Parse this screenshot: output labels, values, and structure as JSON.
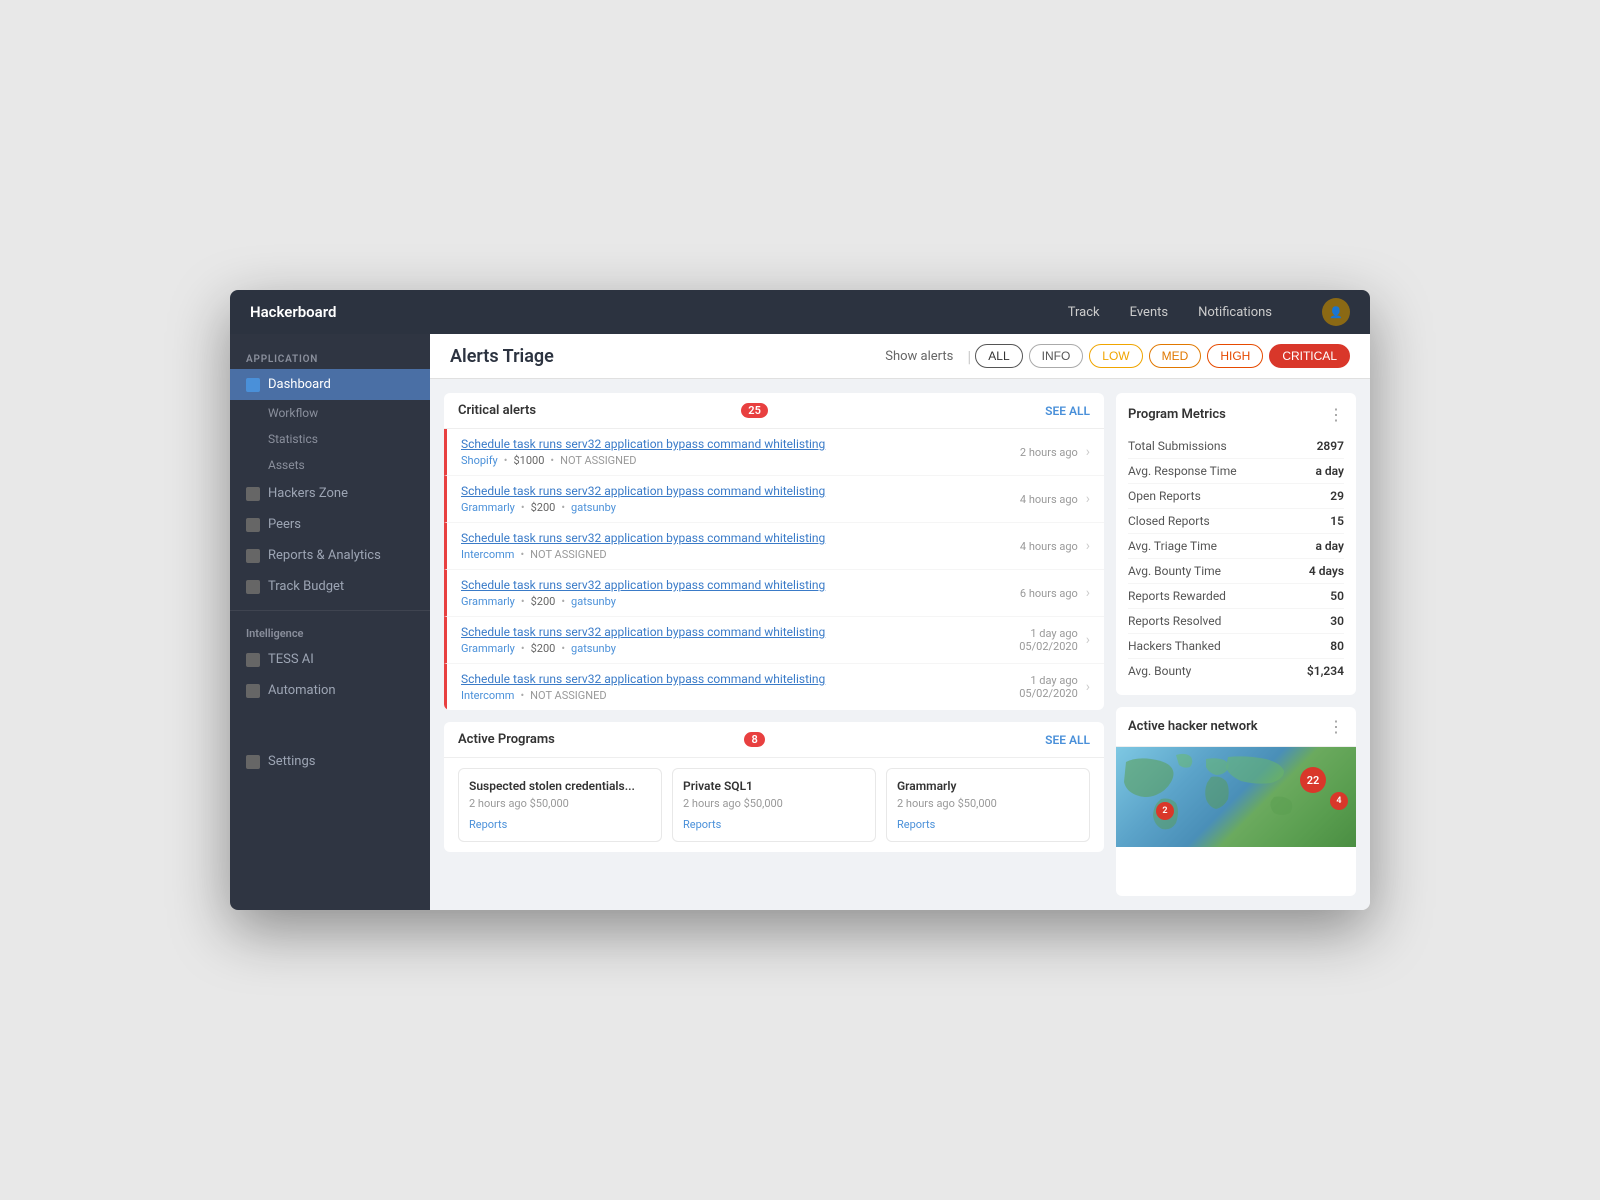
{
  "app": {
    "brand": "Hackerboard",
    "nav_links": [
      "Track",
      "Events",
      "Notifications"
    ]
  },
  "sidebar": {
    "section_application": "APPLICATION",
    "section_intelligence": "Intelligence",
    "items_application": [
      {
        "label": "Dashboard",
        "active": true
      },
      {
        "label": "Workflow",
        "sub": true
      },
      {
        "label": "Statistics",
        "sub": true
      },
      {
        "label": "Assets",
        "sub": true
      },
      {
        "label": "Hackers Zone",
        "active": false
      },
      {
        "label": "Peers",
        "active": false
      },
      {
        "label": "Reports & Analytics",
        "active": false
      },
      {
        "label": "Track Budget",
        "active": false
      }
    ],
    "items_intelligence": [
      {
        "label": "TESS AI"
      },
      {
        "label": "Automation"
      }
    ],
    "settings": "Settings"
  },
  "page": {
    "title": "Alerts Triage",
    "show_alerts": "Show alerts",
    "filters": [
      "ALL",
      "INFO",
      "LOW",
      "MED",
      "HIGH",
      "CRITICAL"
    ]
  },
  "critical_alerts": {
    "title": "Critical alerts",
    "count": 25,
    "see_all": "SEE ALL",
    "items": [
      {
        "title": "Schedule task runs serv32 application bypass command whitelisting",
        "company": "Shopify",
        "amount": "$1000",
        "assigned": "NOT ASSIGNED",
        "time": "2 hours ago",
        "assigned_type": "unassigned"
      },
      {
        "title": "Schedule task runs serv32 application bypass command whitelisting",
        "company": "Grammarly",
        "amount": "$200",
        "assigned": "gatsunby",
        "time": "4 hours ago",
        "assigned_type": "assigned"
      },
      {
        "title": "Schedule task runs serv32 application bypass command whitelisting",
        "company": "Intercomm",
        "amount": "",
        "assigned": "NOT ASSIGNED",
        "time": "4 hours ago",
        "assigned_type": "unassigned"
      },
      {
        "title": "Schedule task runs serv32 application bypass command whitelisting",
        "company": "Grammarly",
        "amount": "$200",
        "assigned": "gatsunby",
        "time": "6 hours ago",
        "assigned_type": "assigned"
      },
      {
        "title": "Schedule task runs serv32 application bypass command whitelisting",
        "company": "Grammarly",
        "amount": "$200",
        "assigned": "gatsunby",
        "time1": "1 day ago",
        "time2": "05/02/2020",
        "assigned_type": "assigned"
      },
      {
        "title": "Schedule task runs serv32 application bypass command whitelisting",
        "company": "Intercomm",
        "amount": "",
        "assigned": "NOT ASSIGNED",
        "time1": "1 day ago",
        "time2": "05/02/2020",
        "assigned_type": "unassigned"
      }
    ]
  },
  "program_metrics": {
    "title": "Program Metrics",
    "metrics": [
      {
        "label": "Total Submissions",
        "value": "2897"
      },
      {
        "label": "Avg. Response Time",
        "value": "a day"
      },
      {
        "label": "Open Reports",
        "value": "29"
      },
      {
        "label": "Closed Reports",
        "value": "15"
      },
      {
        "label": "Avg. Triage Time",
        "value": "a day"
      },
      {
        "label": "Avg. Bounty Time",
        "value": "4 days"
      },
      {
        "label": "Reports Rewarded",
        "value": "50"
      },
      {
        "label": "Reports Resolved",
        "value": "30"
      },
      {
        "label": "Hackers Thanked",
        "value": "80"
      },
      {
        "label": "Avg. Bounty",
        "value": "$1,234"
      }
    ]
  },
  "active_programs": {
    "title": "Active Programs",
    "count": 8,
    "see_all": "SEE ALL",
    "cards": [
      {
        "name": "Suspected stolen credentials...",
        "time": "2 hours ago",
        "bounty": "$50,000",
        "footer": "Reports"
      },
      {
        "name": "Private SQL1",
        "time": "2 hours ago",
        "bounty": "$50,000",
        "footer": "Reports"
      },
      {
        "name": "Grammarly",
        "time": "2 hours ago",
        "bounty": "$50,000",
        "footer": "Reports"
      }
    ]
  },
  "hacker_network": {
    "title": "Active hacker network",
    "badge_large": "22",
    "badge_small": "4"
  }
}
